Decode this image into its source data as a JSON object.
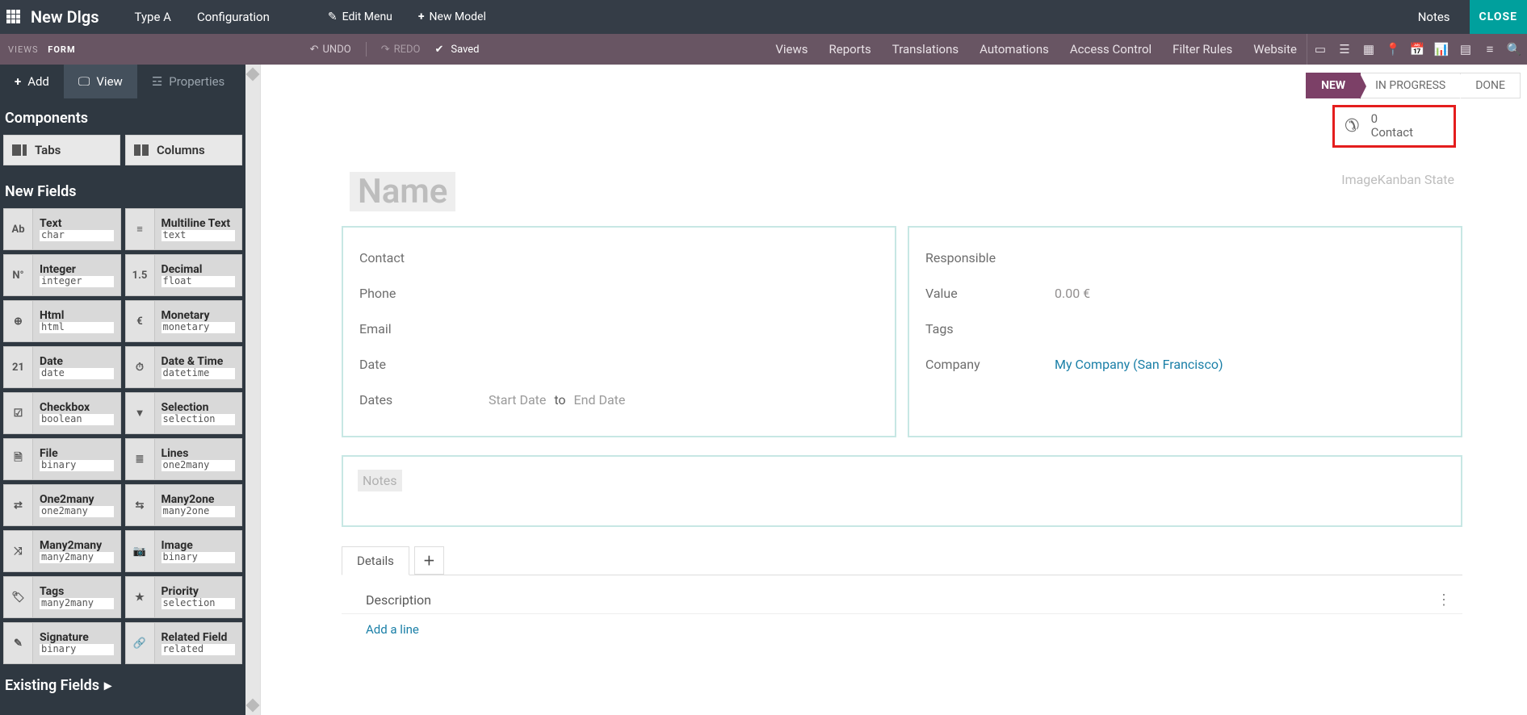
{
  "topbar": {
    "title": "New Dlgs",
    "menu1": "Type A",
    "menu2": "Configuration",
    "edit_menu": "Edit Menu",
    "new_model": "New Model",
    "notes": "Notes",
    "close": "CLOSE"
  },
  "secbar": {
    "views": "VIEWS",
    "form": "FORM",
    "undo": "UNDO",
    "redo": "REDO",
    "saved": "Saved",
    "links": {
      "views": "Views",
      "reports": "Reports",
      "translations": "Translations",
      "automations": "Automations",
      "access": "Access Control",
      "filter": "Filter Rules",
      "website": "Website"
    }
  },
  "sidebar": {
    "tabs": {
      "add": "Add",
      "view": "View",
      "properties": "Properties"
    },
    "components_h": "Components",
    "comp_tabs": "Tabs",
    "comp_cols": "Columns",
    "newfields_h": "New Fields",
    "fields": [
      {
        "icon": "Ab",
        "name": "Text",
        "type": "char"
      },
      {
        "icon": "≡",
        "name": "Multiline Text",
        "type": "text"
      },
      {
        "icon": "N°",
        "name": "Integer",
        "type": "integer"
      },
      {
        "icon": "1.5",
        "name": "Decimal",
        "type": "float"
      },
      {
        "icon": "⊕",
        "name": "Html",
        "type": "html"
      },
      {
        "icon": "€",
        "name": "Monetary",
        "type": "monetary"
      },
      {
        "icon": "21",
        "name": "Date",
        "type": "date"
      },
      {
        "icon": "⏱",
        "name": "Date & Time",
        "type": "datetime"
      },
      {
        "icon": "☑",
        "name": "Checkbox",
        "type": "boolean"
      },
      {
        "icon": "▼",
        "name": "Selection",
        "type": "selection"
      },
      {
        "icon": "🗎",
        "name": "File",
        "type": "binary"
      },
      {
        "icon": "≣",
        "name": "Lines",
        "type": "one2many"
      },
      {
        "icon": "⇄",
        "name": "One2many",
        "type": "one2many"
      },
      {
        "icon": "⇆",
        "name": "Many2one",
        "type": "many2one"
      },
      {
        "icon": "⤨",
        "name": "Many2many",
        "type": "many2many"
      },
      {
        "icon": "📷",
        "name": "Image",
        "type": "binary"
      },
      {
        "icon": "🏷",
        "name": "Tags",
        "type": "many2many"
      },
      {
        "icon": "★",
        "name": "Priority",
        "type": "selection"
      },
      {
        "icon": "✎",
        "name": "Signature",
        "type": "binary"
      },
      {
        "icon": "🔗",
        "name": "Related Field",
        "type": "related"
      }
    ],
    "existing_h": "Existing Fields"
  },
  "status": {
    "new": "NEW",
    "inprogress": "IN PROGRESS",
    "done": "DONE"
  },
  "smartbutton": {
    "count": "0",
    "label": "Contact"
  },
  "form": {
    "name_ph": "Name",
    "imagekanban": "ImageKanban State",
    "left": {
      "contact": "Contact",
      "phone": "Phone",
      "email": "Email",
      "date": "Date",
      "dates": "Dates",
      "start_ph": "Start Date",
      "to": "to",
      "end_ph": "End Date"
    },
    "right": {
      "responsible": "Responsible",
      "value": "Value",
      "value_v": "0.00 €",
      "tags": "Tags",
      "company": "Company",
      "company_v": "My Company (San Francisco)"
    },
    "notes_ph": "Notes"
  },
  "tabs": {
    "details": "Details",
    "description": "Description",
    "addline": "Add a line"
  }
}
